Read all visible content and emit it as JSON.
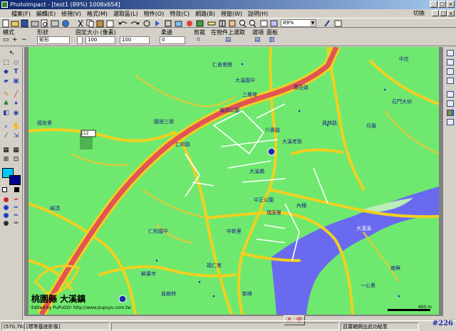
{
  "window": {
    "title": "PhotoImpact - [test1 (89%) 1008x654]",
    "buttons": [
      "_",
      "□",
      "x"
    ]
  },
  "menu": {
    "items": [
      "檔案(F)",
      "編輯(E)",
      "檢視(V)",
      "格式(M)",
      "選取區(L)",
      "物件(O)",
      "特效(C)",
      "網路(B)",
      "視窗(W)",
      "說明(H)"
    ],
    "switch_label": "切換",
    "mdi_buttons": [
      "_",
      "□",
      "x"
    ]
  },
  "toolbar": {
    "zoom_value": "89%",
    "icons": [
      "new-icon",
      "open-icon",
      "save-icon",
      "print-icon",
      "preview-icon",
      "scan-icon",
      "cut-icon",
      "copy-icon",
      "paste-icon",
      "undo-icon",
      "redo-icon",
      "rotate-icon",
      "flip-icon",
      "crop-icon",
      "resize-icon",
      "color-icon",
      "layer-icon",
      "ruler-icon",
      "grid-icon",
      "hand-icon",
      "zoom-in-icon",
      "zoom-out-icon",
      "fit-icon",
      "dropper-icon"
    ]
  },
  "attributes": {
    "mode_label": "模式",
    "shape_label": "形狀",
    "shape_value": "矩形",
    "fixed_size_label": "固定大小 (像素)",
    "width_value": "100",
    "height_value": "100",
    "feather_label": "柔邊",
    "feather_value": "0",
    "crop_label": "剪裁",
    "select_object_label": "在物件上選取",
    "options_label": "選項",
    "panel_label": "面板"
  },
  "map": {
    "title": "桃園縣 大溪鎮",
    "credit": "Edited by PuPuOO! http://www.pupuyu.com.tw",
    "scale_label": "400 m",
    "highway_number": "112",
    "colors": {
      "land": "#6fe86f",
      "highway": "#e05555",
      "road": "#f0d020",
      "river": "#6a6af0",
      "street": "#ffffff"
    },
    "labels": [
      {
        "text": "仁善會館"
      },
      {
        "text": "大溪國中"
      },
      {
        "text": "三層坡"
      },
      {
        "text": "埔頂公園"
      },
      {
        "text": "員林路"
      },
      {
        "text": "國道三號"
      },
      {
        "text": "介壽路"
      },
      {
        "text": "仁和路"
      },
      {
        "text": "康莊路"
      },
      {
        "text": "大溪橋"
      },
      {
        "text": "中正公園"
      },
      {
        "text": "仁和國中"
      },
      {
        "text": "鮮果市"
      },
      {
        "text": "員樹林"
      },
      {
        "text": "福安里"
      },
      {
        "text": "崎頂"
      },
      {
        "text": "大漢溪"
      },
      {
        "text": "瑞源里"
      },
      {
        "text": "中庄"
      },
      {
        "text": "月眉"
      },
      {
        "text": "石門大圳"
      },
      {
        "text": "中新里"
      },
      {
        "text": "一心里"
      },
      {
        "text": "南興"
      },
      {
        "text": "內柵"
      },
      {
        "text": "新峰"
      },
      {
        "text": "福仁宮"
      },
      {
        "text": "大溪老街"
      }
    ]
  },
  "status": {
    "coords": "(570,76)",
    "mode_text": "[標準基底影像]",
    "middle_text": "百寶箱開出武功秘笈",
    "ime": [
      "A",
      "中"
    ],
    "brand": "#226"
  }
}
